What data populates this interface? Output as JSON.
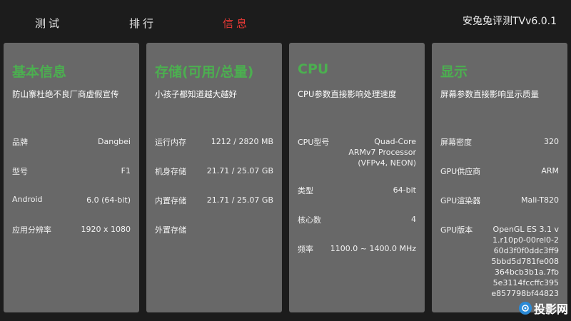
{
  "header": {
    "tabs": [
      {
        "label": "测试",
        "active": false
      },
      {
        "label": "排行",
        "active": false
      },
      {
        "label": "信息",
        "active": true
      }
    ],
    "app_title": "安兔兔评测TVv6.0.1"
  },
  "colors": {
    "accent_tab": "#e53935",
    "card_title": "#4caf50",
    "card_bg": "#686868",
    "page_bg": "#1c1c1c"
  },
  "cards": {
    "basic": {
      "title": "基本信息",
      "subtitle": "防山寨杜绝不良厂商虚假宣传",
      "rows": [
        {
          "label": "品牌",
          "value": "Dangbei"
        },
        {
          "label": "型号",
          "value": "F1"
        },
        {
          "label": "Android",
          "value": "6.0 (64-bit)"
        },
        {
          "label": "应用分辨率",
          "value": "1920 x 1080"
        }
      ]
    },
    "storage": {
      "title": "存储(可用/总量)",
      "subtitle": "小孩子都知道越大越好",
      "rows": [
        {
          "label": "运行内存",
          "value": "1212 / 2820 MB"
        },
        {
          "label": "机身存储",
          "value": "21.71 / 25.07 GB"
        },
        {
          "label": "内置存储",
          "value": "21.71 / 25.07 GB"
        },
        {
          "label": "外置存储",
          "value": ""
        }
      ]
    },
    "cpu": {
      "title": "CPU",
      "subtitle": "CPU参数直接影响处理速度",
      "rows": [
        {
          "label": "CPU型号",
          "value": "Quad-Core ARMv7 Processor (VFPv4, NEON)"
        },
        {
          "label": "类型",
          "value": "64-bit"
        },
        {
          "label": "核心数",
          "value": "4"
        },
        {
          "label": "频率",
          "value": "1100.0 ~ 1400.0 MHz"
        }
      ]
    },
    "display": {
      "title": "显示",
      "subtitle": "屏幕参数直接影响显示质量",
      "rows": [
        {
          "label": "屏幕密度",
          "value": "320"
        },
        {
          "label": "GPU供应商",
          "value": "ARM"
        },
        {
          "label": "GPU渲染器",
          "value": "Mali-T820"
        },
        {
          "label": "GPU版本",
          "value": "OpenGL ES 3.1 v1.r10p0-00rel0-260d3f0f0ddc3ff95bbd5d781fe008364bcb3b1a.7fb5e3114fccffc395e857798bf44823"
        }
      ]
    }
  },
  "watermark": {
    "text": "投影网",
    "icon": "projector-logo-icon"
  }
}
